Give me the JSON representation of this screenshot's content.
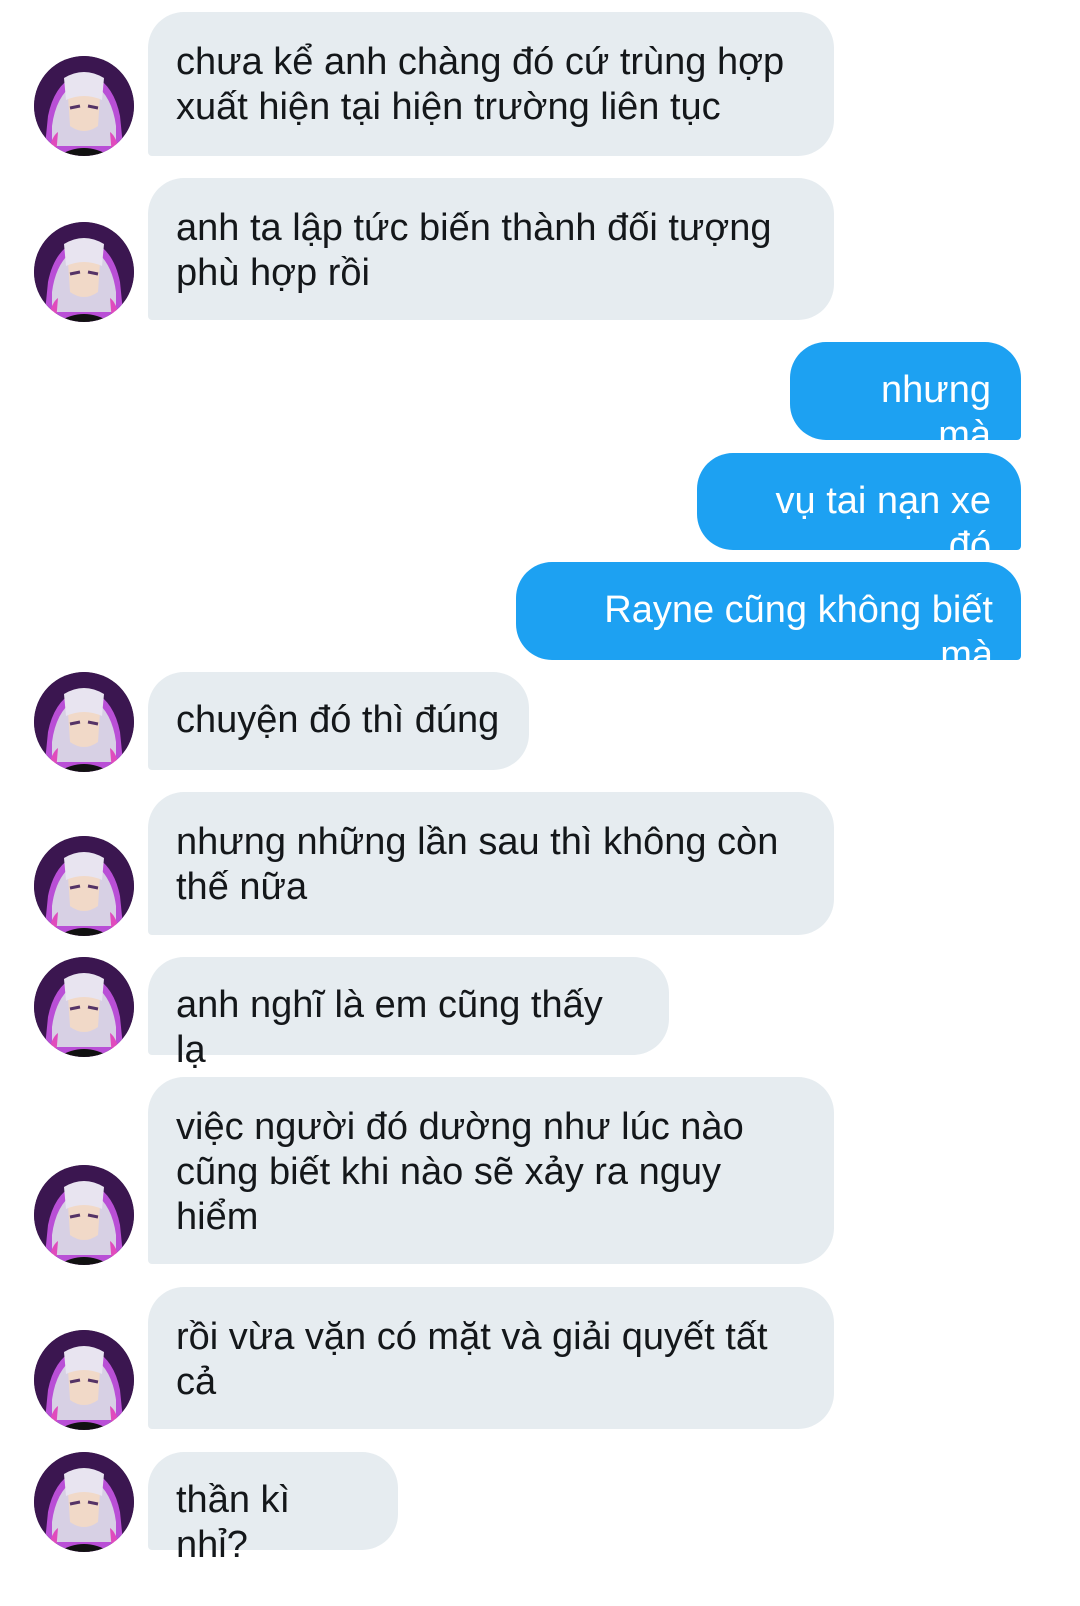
{
  "messages": [
    {
      "from": "other",
      "text": "chưa kể anh chàng đó cứ trùng hợp\nxuất hiện tại hiện trường liên tục",
      "avatar": "user-avatar"
    },
    {
      "from": "other",
      "text": "anh ta lập tức biến thành đối tượng\nphù hợp rồi",
      "avatar": "user-avatar"
    },
    {
      "from": "me",
      "text": "nhưng mà"
    },
    {
      "from": "me",
      "text": "vụ tai nạn xe đó"
    },
    {
      "from": "me",
      "text": "Rayne cũng không biết mà"
    },
    {
      "from": "other",
      "text": "chuyện đó thì đúng",
      "avatar": "user-avatar"
    },
    {
      "from": "other",
      "text": "nhưng những lần sau thì không còn\nthế nữa",
      "avatar": "user-avatar"
    },
    {
      "from": "other",
      "text": "anh nghĩ là em cũng thấy lạ",
      "avatar": "user-avatar"
    },
    {
      "from": "other",
      "text": "việc người đó dường như lúc nào\ncũng biết khi nào sẽ xảy ra nguy\nhiểm",
      "avatar": "user-avatar"
    },
    {
      "from": "other",
      "text": "rồi vừa vặn có mặt và giải quyết tất\ncả",
      "avatar": "user-avatar"
    },
    {
      "from": "other",
      "text": "thần kì nhỉ?",
      "avatar": "user-avatar"
    }
  ],
  "colors": {
    "incoming_bubble": "#e6ecf0",
    "outgoing_bubble": "#1da1f2",
    "incoming_text": "#14171a",
    "outgoing_text": "#ffffff"
  }
}
